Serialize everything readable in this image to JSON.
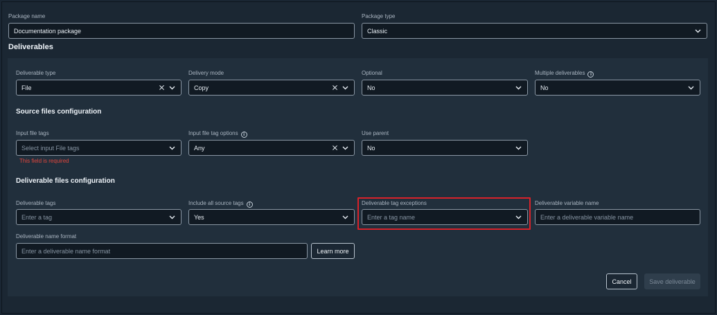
{
  "package": {
    "name_label": "Package name",
    "name_value": "Documentation package",
    "type_label": "Package type",
    "type_value": "Classic"
  },
  "deliverables": {
    "title": "Deliverables",
    "deliverable_type": {
      "label": "Deliverable type",
      "value": "File"
    },
    "delivery_mode": {
      "label": "Delivery mode",
      "value": "Copy"
    },
    "optional": {
      "label": "Optional",
      "value": "No"
    },
    "multiple": {
      "label": "Multiple deliverables",
      "value": "No"
    }
  },
  "source": {
    "title": "Source files configuration",
    "input_tags": {
      "label": "Input file tags",
      "placeholder": "Select input File tags",
      "error": "This field is required"
    },
    "tag_options": {
      "label": "Input file tag options",
      "value": "Any"
    },
    "use_parent": {
      "label": "Use parent",
      "value": "No"
    }
  },
  "deliverable_files": {
    "title": "Deliverable files configuration",
    "tags": {
      "label": "Deliverable tags",
      "placeholder": "Enter a tag"
    },
    "include_source": {
      "label": "Include all source tags",
      "value": "Yes"
    },
    "tag_exceptions": {
      "label": "Deliverable tag exceptions",
      "placeholder": "Enter a tag name"
    },
    "variable_name": {
      "label": "Deliverable variable name",
      "placeholder": "Enter a deliverable variable name"
    },
    "name_format": {
      "label": "Deliverable name format",
      "placeholder": "Enter a deliverable name format"
    },
    "learn_more": "Learn more"
  },
  "actions": {
    "cancel": "Cancel",
    "save": "Save deliverable"
  },
  "icons": {
    "info": "i",
    "chevron": "chevron-down-icon",
    "clear": "clear-icon"
  },
  "colors": {
    "error": "#e0463c",
    "highlight": "#d8222a"
  }
}
